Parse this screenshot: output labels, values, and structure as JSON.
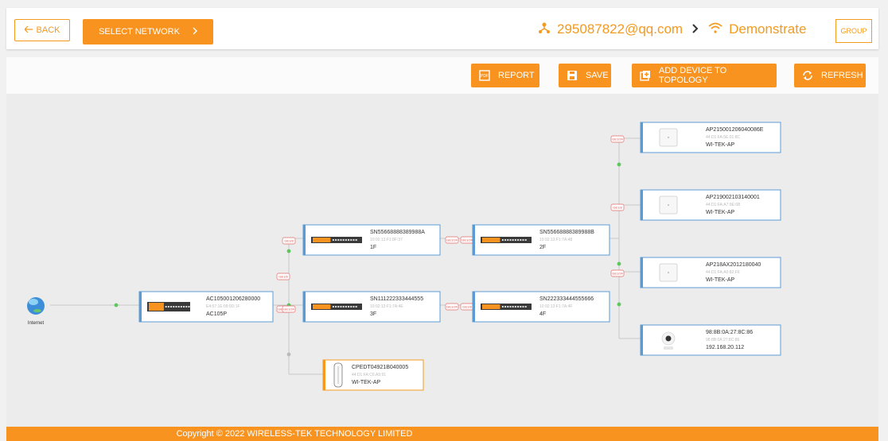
{
  "topbar": {
    "back_label": "BACK",
    "select_network_label": "SELECT NETWORK",
    "account": "295087822@qq.com",
    "network": "Demonstrate",
    "group_label": "GROUP"
  },
  "toolbar": {
    "report_label": "REPORT",
    "save_label": "SAVE",
    "add_device_label": "ADD DEVICE TO TOPOLOGY",
    "refresh_label": "REFRESH"
  },
  "topology": {
    "internet_label": "Internet",
    "devices": [
      {
        "title": "AC105001206280000",
        "mac": "E4:67:1E:09:9D:1F",
        "sub": "AC105P",
        "kind": "ac",
        "accent": "#5b9bd5"
      },
      {
        "title": "SN55668888389988A",
        "mac": "10:92:13:F1:8F:37",
        "sub": "1F",
        "kind": "switch",
        "accent": "#5b9bd5"
      },
      {
        "title": "SN111222333444555",
        "mac": "10:92:13:F1:7A:4E",
        "sub": "3F",
        "kind": "switch",
        "accent": "#5b9bd5"
      },
      {
        "title": "SN55668888389988B",
        "mac": "10:92:13:F1:7A:48",
        "sub": "2F",
        "kind": "switch",
        "accent": "#5b9bd5"
      },
      {
        "title": "SN222333444555666",
        "mac": "10:92:13:F1:7A:4F",
        "sub": "4F",
        "kind": "switch",
        "accent": "#5b9bd5"
      },
      {
        "title": "CPEDT04921B040005",
        "mac": "44:D1:FA:C6:A5:91",
        "sub": "WI-TEK-AP",
        "kind": "cpe",
        "accent": "#f39a1f"
      },
      {
        "title": "AP215001206040086E",
        "mac": "44:D1:FA:5E:01:8C",
        "sub": "WI-TEK-AP",
        "kind": "ap",
        "accent": "#5b9bd5"
      },
      {
        "title": "AP219002103140001",
        "mac": "44:D1:FA:A7:9E:6B",
        "sub": "WI-TEK-AP",
        "kind": "ap",
        "accent": "#5b9bd5"
      },
      {
        "title": "AP218AX2012180040",
        "mac": "44:D1:FA:A0:82:F6",
        "sub": "WI-TEK-AP",
        "kind": "ap",
        "accent": "#5b9bd5"
      },
      {
        "title": "98:8B:0A:27:8C:86",
        "mac": "98:8B:0A:27:8C:86",
        "sub": "192.168.20.112",
        "kind": "camera",
        "accent": "#5b9bd5"
      }
    ],
    "port_badges": [
      "GE1/8",
      "GE1/24",
      "GE1/24",
      "GE1/24",
      "GE1/24",
      "GE1/8",
      "GE1/24",
      "GE1/8",
      "GE1/24",
      "GE1/8",
      "GE1/24"
    ]
  },
  "footer": {
    "copyright": "Copyright © 2022 WIRELESS-TEK TECHNOLOGY LIMITED"
  },
  "colors": {
    "accent": "#f7931e",
    "line": "#c8c8c8",
    "link_dot": "#5cc85c"
  },
  "icons": [
    "arrow-left-icon",
    "chevron-right-icon",
    "network-icon",
    "wifi-icon",
    "pdf-icon",
    "save-icon",
    "add-box-icon",
    "refresh-icon",
    "globe-icon"
  ]
}
